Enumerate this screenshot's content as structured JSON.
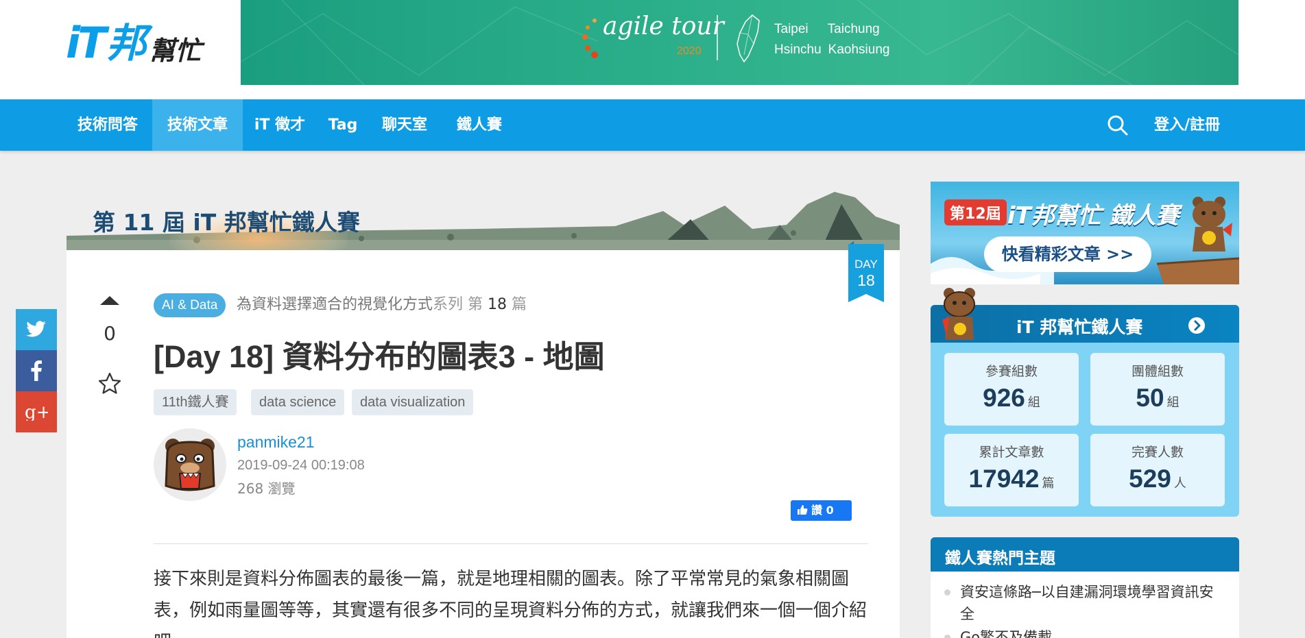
{
  "logo": {
    "it": "iT",
    "bang": "邦",
    "help": "幫忙"
  },
  "banner": {
    "event": "agile tour",
    "year": "2020",
    "cities_row1": [
      "Taipei",
      "Taichung"
    ],
    "cities_row2": [
      "Hsinchu",
      "Kaohsiung"
    ]
  },
  "nav": {
    "items": [
      "技術問答",
      "技術文章",
      "iT 徵才",
      "Tag",
      "聊天室",
      "鐵人賽"
    ],
    "active": "技術文章",
    "login": "登入/註冊"
  },
  "ironman_header": {
    "title": "第 11 屆 iT 邦幫忙鐵人賽"
  },
  "article": {
    "day_label": "DAY",
    "day_number": "18",
    "votes": "0",
    "category": "AI & Data",
    "series_name": "為資料選擇適合的視覺化方式",
    "series_word": "系列",
    "episode_prefix": "第",
    "episode_number": "18",
    "episode_suffix": "篇",
    "title": "[Day 18] 資料分布的圖表3 - 地圖",
    "tags": [
      "11th鐵人賽",
      "data science",
      "data visualization"
    ],
    "author": "panmike21",
    "date": "2019-09-24 00:19:08",
    "views": "268 瀏覽",
    "like_label": "讚",
    "like_count": "0",
    "body": "接下來則是資料分佈圖表的最後一篇，就是地理相關的圖表。除了平常常見的氣象相關圖表，例如雨量圖等等，其實還有很多不同的呈現資料分佈的方式，就讓我們來一個一個介紹吧。"
  },
  "ad": {
    "edition_number": "12",
    "edition_prefix": "第",
    "edition_suffix": "屆",
    "title": "iT邦幫忙 鐵人賽",
    "button": "快看精彩文章 >>"
  },
  "iron_panel": {
    "title": "iT 邦幫忙鐵人賽",
    "stats": [
      {
        "label": "參賽組數",
        "value": "926",
        "unit": "組"
      },
      {
        "label": "團體組數",
        "value": "50",
        "unit": "組"
      },
      {
        "label": "累計文章數",
        "value": "17942",
        "unit": "篇"
      },
      {
        "label": "完賽人數",
        "value": "529",
        "unit": "人"
      }
    ]
  },
  "hot_topics": {
    "title": "鐵人賽熱門主題",
    "items": [
      "資安這條路─以自建漏洞環境學習資訊安全",
      "Go繁不及備載"
    ]
  },
  "colors": {
    "nav_bg": "#0e9de5",
    "nav_active": "#3cb2ec",
    "brand": "#0c9ee8",
    "panel_bg": "#7fd4f5"
  }
}
